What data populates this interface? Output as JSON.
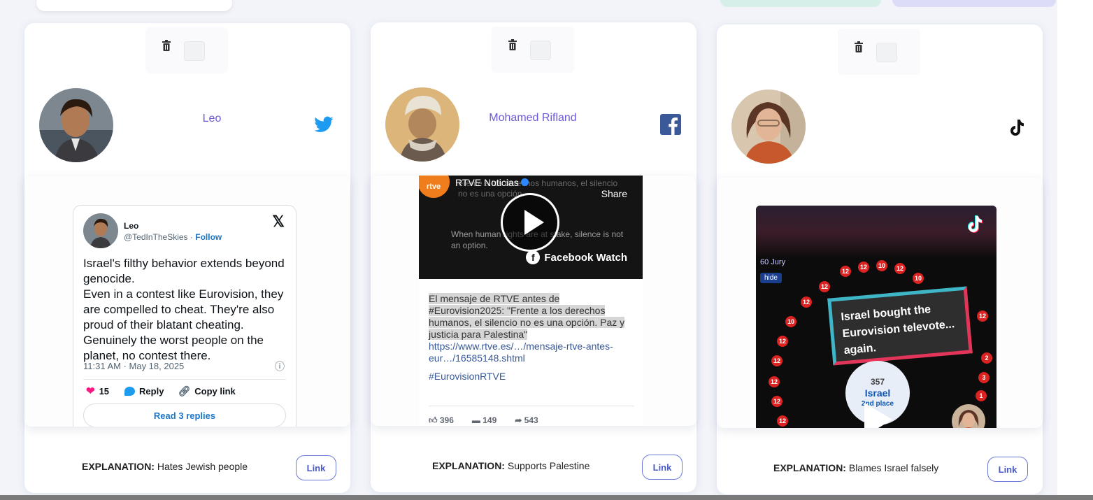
{
  "posts": [
    {
      "name": "Leo",
      "platform": "twitter",
      "explanation_label": "EXPLANATION:",
      "explanation": "Hates Jewish people",
      "link_label": "Link",
      "embed": {
        "type": "tweet",
        "author": "Leo",
        "handle": "@TedInTheSkies · ",
        "follow_label": "Follow",
        "text": "Israel's filthy behavior extends beyond genocide.\nEven in a contest like Eurovision, they are compelled to cheat. They're also proud of their blatant cheating. Genuinely the worst people on the planet, no contest there.",
        "timestamp": "11:31 AM · May 18, 2025",
        "likes": "15",
        "reply_label": "Reply",
        "copy_label": "Copy link",
        "replies_label": "Read 3 replies"
      }
    },
    {
      "name": "Mohamed Rifland",
      "platform": "facebook",
      "explanation_label": "EXPLANATION:",
      "explanation": "Supports Palestine",
      "link_label": "Link",
      "embed": {
        "type": "facebook",
        "page_name": "RTVE Noticias",
        "logo_text": "rtve",
        "logo_sub": "Noticias",
        "share_label": "Share",
        "overlay_es": "Frente a los derechos humanos, el silencio no es una opción.",
        "overlay_en": "When human rights are at stake, silence is not an option.",
        "watch_label": "Facebook Watch",
        "body": "El mensaje de RTVE antes de #Eurovision2025: \"Frente a los derechos humanos, el silencio no es una opción. Paz y justicia para Palestina\"",
        "url": "https://www.rtve.es/…/mensaje-rtve-antes-eur…/16585148.shtml",
        "hashtag": "#EurovisionRTVE",
        "likes": "396",
        "comments": "149",
        "shares": "543"
      }
    },
    {
      "name": "",
      "platform": "tiktok",
      "explanation_label": "EXPLANATION:",
      "explanation": "Blames Israel falsely",
      "link_label": "Link",
      "embed": {
        "type": "tiktok",
        "jury_label": "60 Jury",
        "hide_label": "hide",
        "caption": "Israel bought the Eurovision televote... again.",
        "israel_label": "Israel",
        "score": "357",
        "place": "2nd place"
      }
    }
  ],
  "colors": {
    "accent": "#6a5bd6",
    "twitter": "#1d9bf0",
    "facebook": "#3b5998",
    "link_border": "#6b79d8"
  }
}
